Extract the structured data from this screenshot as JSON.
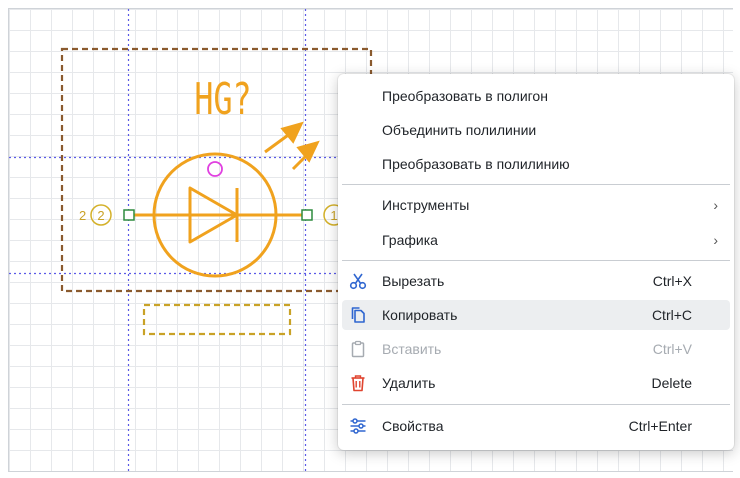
{
  "symbol": {
    "designator": "HG?",
    "pin_left_label": "2",
    "pin_left_number": "2",
    "pin_right_number": "1"
  },
  "menu": {
    "convert_polygon": "Преобразовать в полигон",
    "merge_polylines": "Объединить полилинии",
    "convert_polyline": "Преобразовать в полилинию",
    "tools": "Инструменты",
    "graphics": "Графика",
    "cut": "Вырезать",
    "cut_shortcut": "Ctrl+X",
    "copy": "Копировать",
    "copy_shortcut": "Ctrl+C",
    "paste": "Вставить",
    "paste_shortcut": "Ctrl+V",
    "delete": "Удалить",
    "delete_shortcut": "Delete",
    "properties": "Свойства",
    "properties_shortcut": "Ctrl+Enter",
    "submenu_arrow": "›"
  },
  "icons": {
    "cut": "scissors-icon",
    "copy": "copy-icon",
    "paste": "clipboard-icon",
    "delete": "trash-icon",
    "properties": "sliders-icon"
  },
  "colors": {
    "symbol": "#f0a21e",
    "designator_box": "#8a5a2e",
    "guide_lines": "#5a5ae6",
    "pin_marker": "#2e8b3e",
    "pin_number": "#d4b12a",
    "delete_icon": "#e0442f",
    "highlight": "#eceef0"
  }
}
